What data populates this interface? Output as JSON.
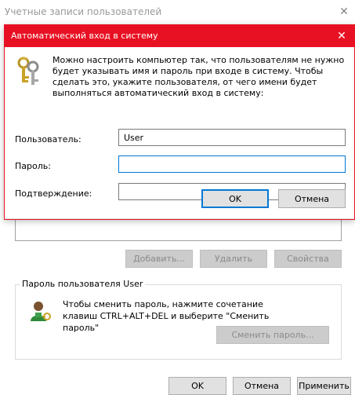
{
  "background_window": {
    "title": "Учетные записи пользователей",
    "close_glyph": "✕",
    "buttons": {
      "add": "Добавить...",
      "remove": "Удалить",
      "properties": "Свойства"
    },
    "password_group": {
      "title": "Пароль пользователя User",
      "text": "Чтобы сменить пароль, нажмите сочетание клавиш CTRL+ALT+DEL и выберите \"Сменить пароль\"",
      "change_button": "Сменить пароль...",
      "icon": "user-key-icon"
    },
    "footer": {
      "ok": "OK",
      "cancel": "Отмена",
      "apply": "Применить"
    }
  },
  "dialog": {
    "title": "Автоматический вход в систему",
    "close_glyph": "✕",
    "icon": "keys-icon",
    "description": "Можно настроить компьютер так, что пользователям не нужно будет указывать имя и пароль при входе в систему. Чтобы сделать это, укажите пользователя, от чего имени будет выполняться автоматический вход в систему:",
    "fields": {
      "user_label": "Пользователь:",
      "user_value": "User",
      "password_label": "Пароль:",
      "password_value": "",
      "confirm_label": "Подтверждение:",
      "confirm_value": ""
    },
    "buttons": {
      "ok": "OK",
      "cancel": "Отмена"
    },
    "accent_color": "#e81123",
    "focus_color": "#0078d7"
  }
}
